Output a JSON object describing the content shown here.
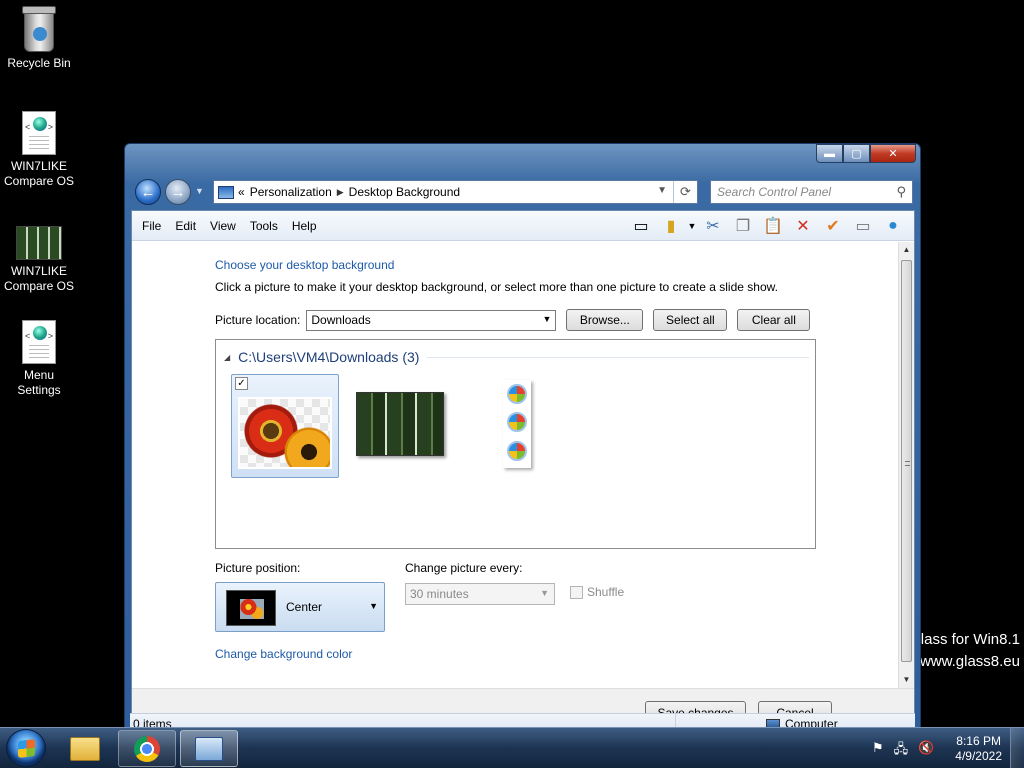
{
  "desktop": {
    "icons": [
      {
        "label_line1": "Recycle Bin",
        "label_line2": ""
      },
      {
        "label_line1": "WIN7LIKE",
        "label_line2": "Compare OS"
      },
      {
        "label_line1": "WIN7LIKE",
        "label_line2": "Compare OS"
      },
      {
        "label_line1": "Menu",
        "label_line2": "Settings"
      }
    ],
    "watermark_line1": "lass for Win8.1",
    "watermark_line2": "www.glass8.eu"
  },
  "window": {
    "caption": {
      "minimize": "▬",
      "maximize": "▢",
      "close": "✕"
    },
    "address": {
      "overflow": "«",
      "crumbs": [
        "Personalization",
        "Desktop Background"
      ]
    },
    "search_placeholder": "Search Control Panel",
    "menu": [
      "File",
      "Edit",
      "View",
      "Tools",
      "Help"
    ],
    "page": {
      "title": "Choose your desktop background",
      "description": "Click a picture to make it your desktop background, or select more than one picture to create a slide show.",
      "location_label": "Picture location:",
      "location_value": "Downloads",
      "browse": "Browse...",
      "select_all": "Select all",
      "clear_all": "Clear all",
      "group_title": "C:\\Users\\VM4\\Downloads (3)",
      "position_label": "Picture position:",
      "position_value": "Center",
      "change_every_label": "Change picture every:",
      "change_every_value": "30 minutes",
      "shuffle_label": "Shuffle",
      "bg_color_link": "Change background color"
    },
    "footer": {
      "save": "Save changes",
      "cancel": "Cancel"
    },
    "status": {
      "items": "0 items",
      "location": "Computer"
    }
  },
  "taskbar": {
    "time": "8:16 PM",
    "date": "4/9/2022"
  }
}
